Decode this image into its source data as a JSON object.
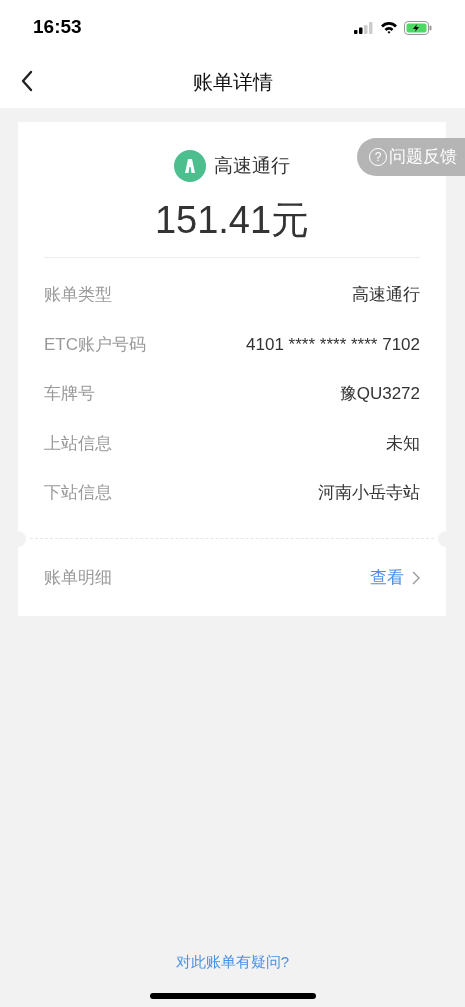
{
  "status_bar": {
    "time": "16:53"
  },
  "nav": {
    "title": "账单详情"
  },
  "feedback_button": {
    "icon": "?",
    "label": "问题反馈"
  },
  "summary": {
    "category": "高速通行",
    "amount": "151.41元"
  },
  "details": [
    {
      "label": "账单类型",
      "value": "高速通行"
    },
    {
      "label": "ETC账户号码",
      "value": "4101 **** **** **** 7102"
    },
    {
      "label": "车牌号",
      "value": "豫QU3272"
    },
    {
      "label": "上站信息",
      "value": "未知"
    },
    {
      "label": "下站信息",
      "value": "河南小岳寺站"
    }
  ],
  "bill_items": {
    "label": "账单明细",
    "link": "查看"
  },
  "footer_link": "对此账单有疑问?"
}
